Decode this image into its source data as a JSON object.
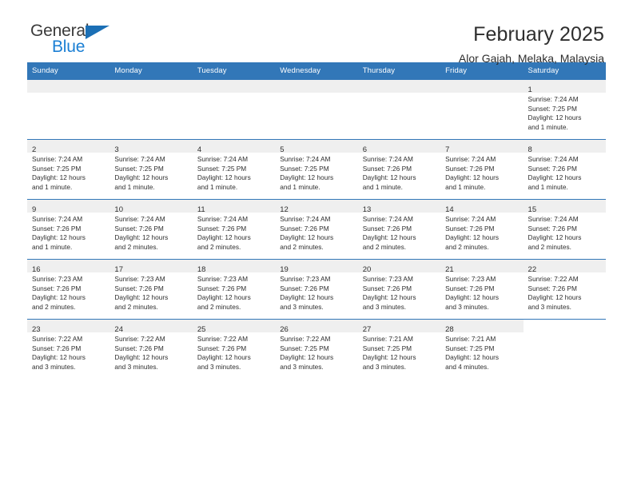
{
  "brand": {
    "name_top": "General",
    "name_bottom": "Blue",
    "accent_color": "#1b7fd4",
    "triangle_color": "#1b6fb5",
    "triangle_icon": "triangle-icon"
  },
  "header": {
    "title": "February 2025",
    "subtitle": "Alor Gajah, Melaka, Malaysia"
  },
  "theme": {
    "header_row_bg": "#3277b8",
    "header_row_text": "#ffffff",
    "daynum_strip_bg": "#efefef",
    "row_divider": "#3277b8",
    "body_text": "#2e2e2e"
  },
  "weekdays": [
    "Sunday",
    "Monday",
    "Tuesday",
    "Wednesday",
    "Thursday",
    "Friday",
    "Saturday"
  ],
  "labels": {
    "sunrise_prefix": "Sunrise: ",
    "sunset_prefix": "Sunset: ",
    "daylight_prefix": "Daylight: "
  },
  "weeks": [
    [
      {
        "day": "",
        "empty": true
      },
      {
        "day": "",
        "empty": true
      },
      {
        "day": "",
        "empty": true
      },
      {
        "day": "",
        "empty": true
      },
      {
        "day": "",
        "empty": true
      },
      {
        "day": "",
        "empty": true
      },
      {
        "day": "1",
        "sunrise": "Sunrise: 7:24 AM",
        "sunset": "Sunset: 7:25 PM",
        "daylight1": "Daylight: 12 hours",
        "daylight2": "and 1 minute."
      }
    ],
    [
      {
        "day": "2",
        "sunrise": "Sunrise: 7:24 AM",
        "sunset": "Sunset: 7:25 PM",
        "daylight1": "Daylight: 12 hours",
        "daylight2": "and 1 minute."
      },
      {
        "day": "3",
        "sunrise": "Sunrise: 7:24 AM",
        "sunset": "Sunset: 7:25 PM",
        "daylight1": "Daylight: 12 hours",
        "daylight2": "and 1 minute."
      },
      {
        "day": "4",
        "sunrise": "Sunrise: 7:24 AM",
        "sunset": "Sunset: 7:25 PM",
        "daylight1": "Daylight: 12 hours",
        "daylight2": "and 1 minute."
      },
      {
        "day": "5",
        "sunrise": "Sunrise: 7:24 AM",
        "sunset": "Sunset: 7:25 PM",
        "daylight1": "Daylight: 12 hours",
        "daylight2": "and 1 minute."
      },
      {
        "day": "6",
        "sunrise": "Sunrise: 7:24 AM",
        "sunset": "Sunset: 7:26 PM",
        "daylight1": "Daylight: 12 hours",
        "daylight2": "and 1 minute."
      },
      {
        "day": "7",
        "sunrise": "Sunrise: 7:24 AM",
        "sunset": "Sunset: 7:26 PM",
        "daylight1": "Daylight: 12 hours",
        "daylight2": "and 1 minute."
      },
      {
        "day": "8",
        "sunrise": "Sunrise: 7:24 AM",
        "sunset": "Sunset: 7:26 PM",
        "daylight1": "Daylight: 12 hours",
        "daylight2": "and 1 minute."
      }
    ],
    [
      {
        "day": "9",
        "sunrise": "Sunrise: 7:24 AM",
        "sunset": "Sunset: 7:26 PM",
        "daylight1": "Daylight: 12 hours",
        "daylight2": "and 1 minute."
      },
      {
        "day": "10",
        "sunrise": "Sunrise: 7:24 AM",
        "sunset": "Sunset: 7:26 PM",
        "daylight1": "Daylight: 12 hours",
        "daylight2": "and 2 minutes."
      },
      {
        "day": "11",
        "sunrise": "Sunrise: 7:24 AM",
        "sunset": "Sunset: 7:26 PM",
        "daylight1": "Daylight: 12 hours",
        "daylight2": "and 2 minutes."
      },
      {
        "day": "12",
        "sunrise": "Sunrise: 7:24 AM",
        "sunset": "Sunset: 7:26 PM",
        "daylight1": "Daylight: 12 hours",
        "daylight2": "and 2 minutes."
      },
      {
        "day": "13",
        "sunrise": "Sunrise: 7:24 AM",
        "sunset": "Sunset: 7:26 PM",
        "daylight1": "Daylight: 12 hours",
        "daylight2": "and 2 minutes."
      },
      {
        "day": "14",
        "sunrise": "Sunrise: 7:24 AM",
        "sunset": "Sunset: 7:26 PM",
        "daylight1": "Daylight: 12 hours",
        "daylight2": "and 2 minutes."
      },
      {
        "day": "15",
        "sunrise": "Sunrise: 7:24 AM",
        "sunset": "Sunset: 7:26 PM",
        "daylight1": "Daylight: 12 hours",
        "daylight2": "and 2 minutes."
      }
    ],
    [
      {
        "day": "16",
        "sunrise": "Sunrise: 7:23 AM",
        "sunset": "Sunset: 7:26 PM",
        "daylight1": "Daylight: 12 hours",
        "daylight2": "and 2 minutes."
      },
      {
        "day": "17",
        "sunrise": "Sunrise: 7:23 AM",
        "sunset": "Sunset: 7:26 PM",
        "daylight1": "Daylight: 12 hours",
        "daylight2": "and 2 minutes."
      },
      {
        "day": "18",
        "sunrise": "Sunrise: 7:23 AM",
        "sunset": "Sunset: 7:26 PM",
        "daylight1": "Daylight: 12 hours",
        "daylight2": "and 2 minutes."
      },
      {
        "day": "19",
        "sunrise": "Sunrise: 7:23 AM",
        "sunset": "Sunset: 7:26 PM",
        "daylight1": "Daylight: 12 hours",
        "daylight2": "and 3 minutes."
      },
      {
        "day": "20",
        "sunrise": "Sunrise: 7:23 AM",
        "sunset": "Sunset: 7:26 PM",
        "daylight1": "Daylight: 12 hours",
        "daylight2": "and 3 minutes."
      },
      {
        "day": "21",
        "sunrise": "Sunrise: 7:23 AM",
        "sunset": "Sunset: 7:26 PM",
        "daylight1": "Daylight: 12 hours",
        "daylight2": "and 3 minutes."
      },
      {
        "day": "22",
        "sunrise": "Sunrise: 7:22 AM",
        "sunset": "Sunset: 7:26 PM",
        "daylight1": "Daylight: 12 hours",
        "daylight2": "and 3 minutes."
      }
    ],
    [
      {
        "day": "23",
        "sunrise": "Sunrise: 7:22 AM",
        "sunset": "Sunset: 7:26 PM",
        "daylight1": "Daylight: 12 hours",
        "daylight2": "and 3 minutes."
      },
      {
        "day": "24",
        "sunrise": "Sunrise: 7:22 AM",
        "sunset": "Sunset: 7:26 PM",
        "daylight1": "Daylight: 12 hours",
        "daylight2": "and 3 minutes."
      },
      {
        "day": "25",
        "sunrise": "Sunrise: 7:22 AM",
        "sunset": "Sunset: 7:26 PM",
        "daylight1": "Daylight: 12 hours",
        "daylight2": "and 3 minutes."
      },
      {
        "day": "26",
        "sunrise": "Sunrise: 7:22 AM",
        "sunset": "Sunset: 7:25 PM",
        "daylight1": "Daylight: 12 hours",
        "daylight2": "and 3 minutes."
      },
      {
        "day": "27",
        "sunrise": "Sunrise: 7:21 AM",
        "sunset": "Sunset: 7:25 PM",
        "daylight1": "Daylight: 12 hours",
        "daylight2": "and 3 minutes."
      },
      {
        "day": "28",
        "sunrise": "Sunrise: 7:21 AM",
        "sunset": "Sunset: 7:25 PM",
        "daylight1": "Daylight: 12 hours",
        "daylight2": "and 4 minutes."
      },
      {
        "day": "",
        "empty": true,
        "blank": true
      }
    ]
  ]
}
